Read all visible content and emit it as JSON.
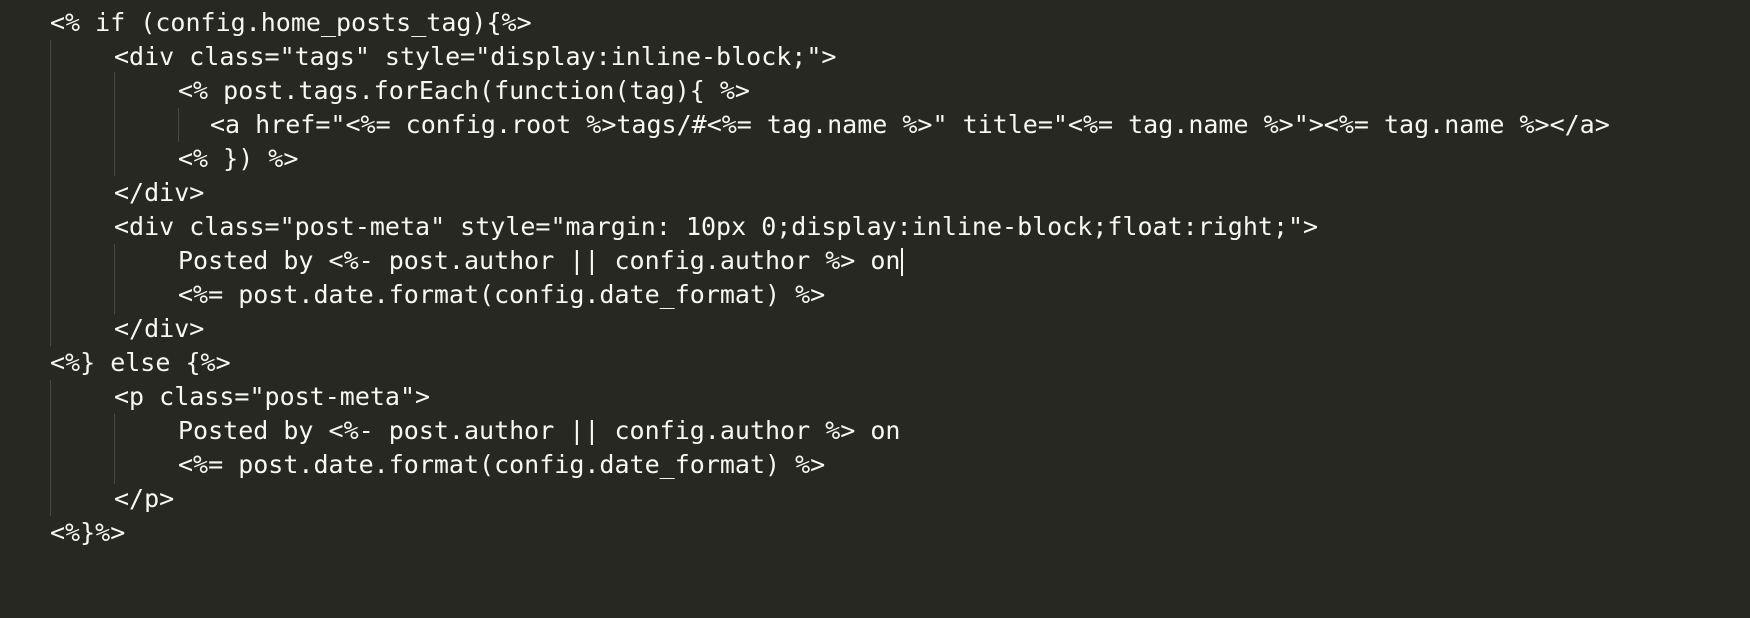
{
  "editor": {
    "colors": {
      "background": "#272822",
      "foreground": "#f8f8f2",
      "indent_guide": "#4a4a44",
      "caret": "#f8f8f0"
    },
    "lines": [
      "<% if (config.home_posts_tag){%>",
      "<div class=\"tags\" style=\"display:inline-block;\">",
      "<% post.tags.forEach(function(tag){ %>",
      "<a href=\"<%= config.root %>tags/#<%= tag.name %>\" title=\"<%= tag.name %>\"><%= tag.name %></a>",
      "<% }) %>",
      "</div>",
      "<div class=\"post-meta\" style=\"margin: 10px 0;display:inline-block;float:right;\">",
      "Posted by <%- post.author || config.author %> on",
      "<%= post.date.format(config.date_format) %>",
      "</div>",
      "<%} else {%>",
      "<p class=\"post-meta\">",
      "Posted by <%- post.author || config.author %> on",
      "<%= post.date.format(config.date_format) %>",
      "</p>",
      "<%}%>"
    ]
  }
}
